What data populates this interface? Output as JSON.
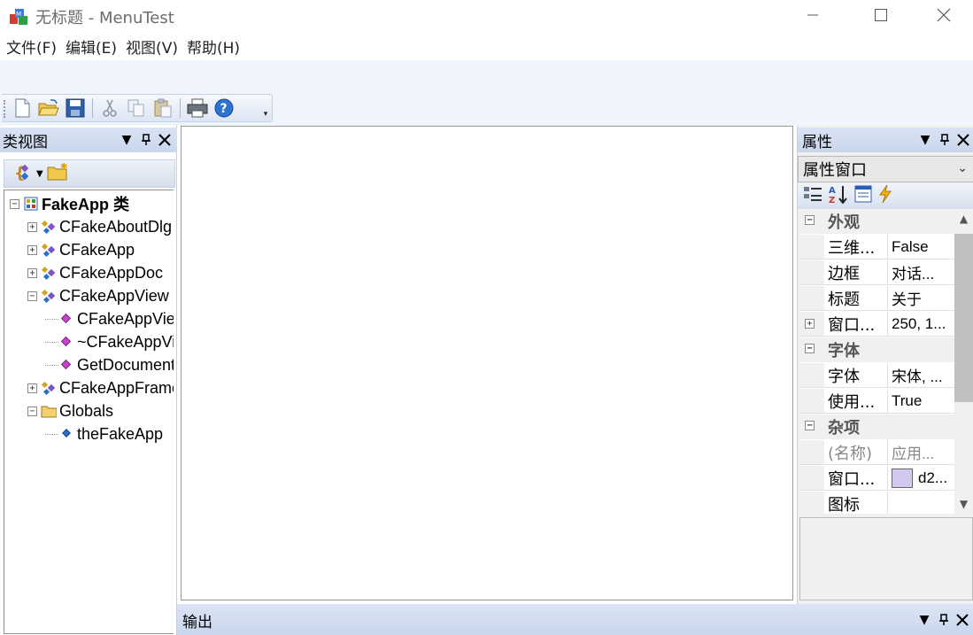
{
  "window": {
    "title": "无标题 - MenuTest"
  },
  "menu": [
    "文件(F)",
    "编辑(E)",
    "视图(V)",
    "帮助(H)"
  ],
  "toolbar": {
    "buttons": [
      "new-icon",
      "open-icon",
      "save-icon",
      "cut-icon",
      "copy-icon",
      "paste-icon",
      "print-icon",
      "help-icon"
    ]
  },
  "classview": {
    "title": "类视图",
    "tree": [
      {
        "label": "FakeApp 类",
        "level": 0,
        "expander": "−",
        "icon": "project-icon",
        "bold": true
      },
      {
        "label": "CFakeAboutDlg",
        "level": 1,
        "expander": "+",
        "icon": "class-icon"
      },
      {
        "label": "CFakeApp",
        "level": 1,
        "expander": "+",
        "icon": "class-icon"
      },
      {
        "label": "CFakeAppDoc",
        "level": 1,
        "expander": "+",
        "icon": "class-icon"
      },
      {
        "label": "CFakeAppView",
        "level": 1,
        "expander": "−",
        "icon": "class-icon"
      },
      {
        "label": "CFakeAppView",
        "level": 2,
        "icon": "method-icon"
      },
      {
        "label": "~CFakeAppView",
        "level": 2,
        "icon": "method-icon"
      },
      {
        "label": "GetDocument",
        "level": 2,
        "icon": "method-icon"
      },
      {
        "label": "CFakeAppFrame",
        "level": 1,
        "expander": "+",
        "icon": "class-icon"
      },
      {
        "label": "Globals",
        "level": 1,
        "expander": "−",
        "icon": "folder-icon"
      },
      {
        "label": "theFakeApp",
        "level": 2,
        "icon": "variable-icon"
      }
    ]
  },
  "properties": {
    "title": "属性",
    "combo": "属性窗口",
    "rows": [
      {
        "type": "category",
        "label": "外观",
        "toggle": "−"
      },
      {
        "type": "prop",
        "name": "三维...",
        "value": "False"
      },
      {
        "type": "prop",
        "name": "边框",
        "value": "对话..."
      },
      {
        "type": "prop",
        "name": "标题",
        "value": "关于"
      },
      {
        "type": "prop",
        "name": "窗口...",
        "value": "250, 1...",
        "toggle": "+"
      },
      {
        "type": "category",
        "label": "字体",
        "toggle": "−"
      },
      {
        "type": "prop",
        "name": "字体",
        "value": "宋体, ..."
      },
      {
        "type": "prop",
        "name": "使用...",
        "value": "True"
      },
      {
        "type": "category",
        "label": "杂项",
        "toggle": "−"
      },
      {
        "type": "prop",
        "name": "(名称)",
        "value": "应用...",
        "dim": true
      },
      {
        "type": "prop",
        "name": "窗口...",
        "value": "d2...",
        "swatch": "#d2c8f0"
      },
      {
        "type": "prop",
        "name": "图标",
        "value": ""
      }
    ]
  },
  "output": {
    "title": "输出"
  },
  "colors": {
    "pane_header": "#d0dcef",
    "toolbar_bg": "#f0f4fb",
    "border": "#c5d1e6"
  }
}
